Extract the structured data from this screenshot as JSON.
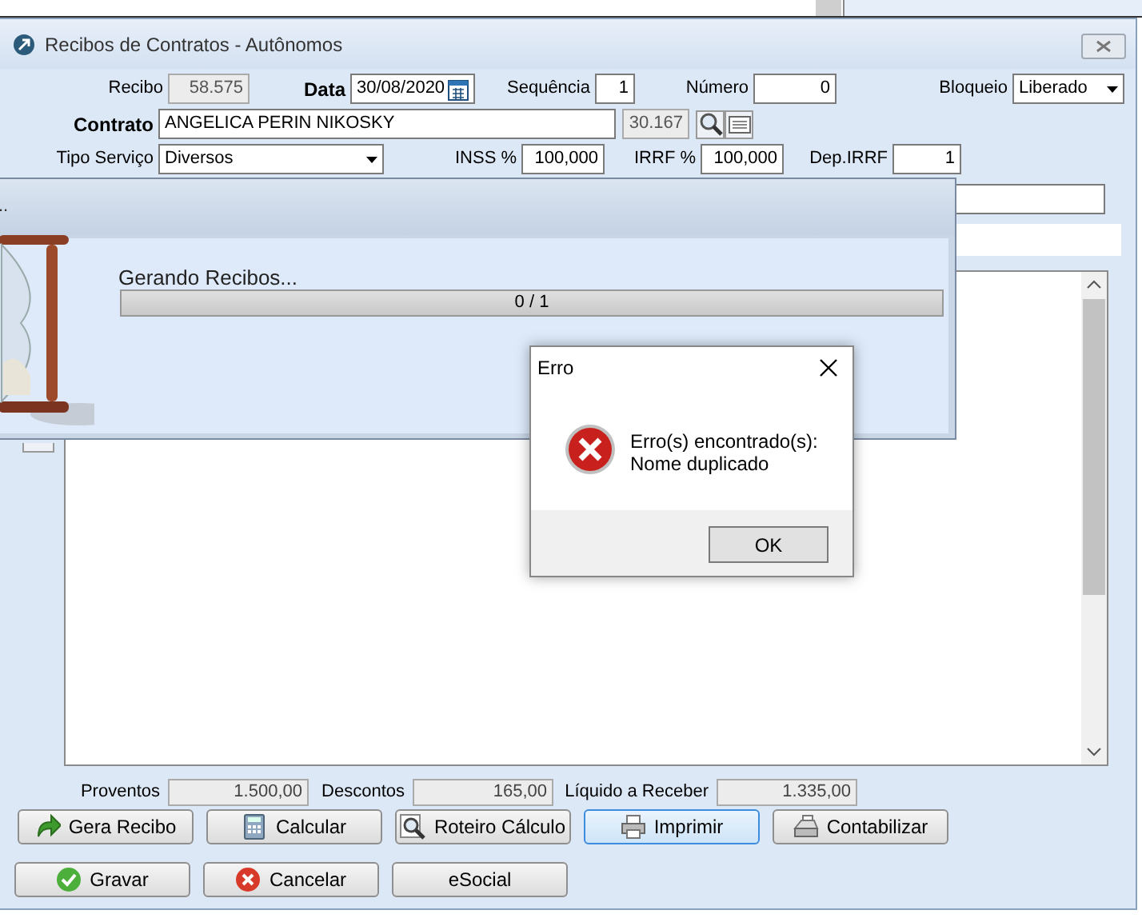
{
  "window": {
    "title": "Recibos de Contratos - Autônomos"
  },
  "rows": [
    [
      {
        "label": "Recibo",
        "value": "58.575",
        "kind": "readonly",
        "label_bold": false
      },
      {
        "label": "Data",
        "value": "30/08/2020",
        "kind": "date",
        "label_bold": true
      },
      {
        "label": "Sequência",
        "value": "1",
        "kind": "number",
        "label_bold": false
      },
      {
        "label": "Número",
        "value": "0",
        "kind": "number",
        "label_bold": false
      },
      {
        "label": "Bloqueio",
        "value": "Liberado",
        "kind": "dropdown",
        "label_bold": false
      }
    ],
    [
      {
        "label": "Contrato",
        "value": "ANGELICA PERIN NIKOSKY",
        "kind": "text",
        "label_bold": true
      },
      {
        "value": "30.167",
        "kind": "code"
      }
    ],
    [
      {
        "label": "Tipo Serviço",
        "value": "Diversos",
        "kind": "dropdown",
        "label_bold": false
      },
      {
        "label": "INSS %",
        "value": "100,000",
        "kind": "number",
        "label_bold": false
      },
      {
        "label": "IRRF %",
        "value": "100,000",
        "kind": "number",
        "label_bold": false
      },
      {
        "label": "Dep.IRRF",
        "value": "1",
        "kind": "number",
        "label_bold": false
      }
    ]
  ],
  "totals": [
    {
      "label": "Proventos",
      "value": "1.500,00"
    },
    {
      "label": "Descontos",
      "value": "165,00"
    },
    {
      "label": "Líquido a Receber",
      "value": "1.335,00"
    }
  ],
  "action_buttons": [
    {
      "label": "Gera Recibo",
      "kind": "arrow",
      "focused": false
    },
    {
      "label": "Calcular",
      "kind": "calculator",
      "focused": false
    },
    {
      "label": "Roteiro Cálculo",
      "kind": "magnifier",
      "focused": false
    },
    {
      "label": "Imprimir",
      "kind": "printer",
      "focused": true
    },
    {
      "label": "Contabilizar",
      "kind": "register",
      "focused": false
    }
  ],
  "footer_buttons": [
    {
      "label": "Gravar",
      "kind": "check"
    },
    {
      "label": "Cancelar",
      "kind": "cancel"
    },
    {
      "label": "eSocial",
      "kind": "plain"
    }
  ],
  "progress_dialog": {
    "title": "..",
    "message": "Gerando Recibos...",
    "progress_text": "0 / 1",
    "level": 0
  },
  "error_dialog": {
    "title": "Erro",
    "message": [
      "Erro(s) encontrado(s):",
      "Nome duplicado"
    ],
    "button": "OK"
  }
}
